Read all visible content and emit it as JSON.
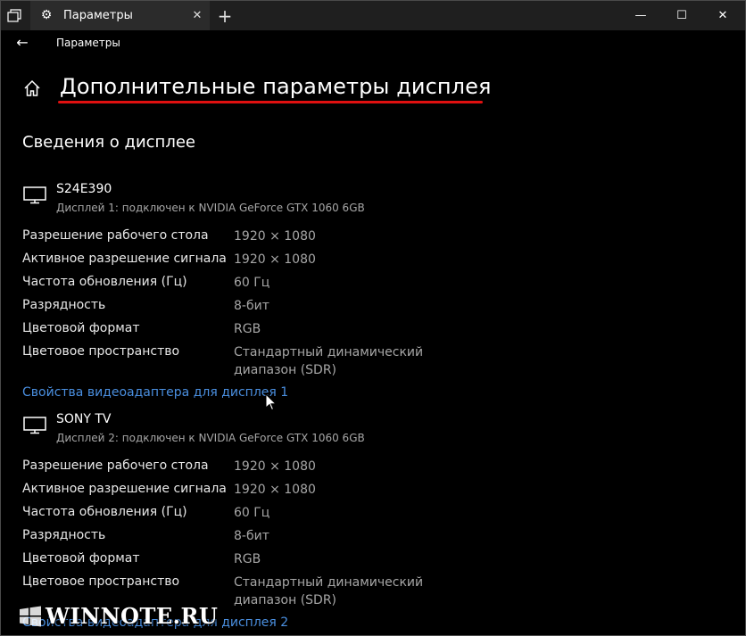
{
  "tab": {
    "title": "Параметры"
  },
  "nav": {
    "title": "Параметры"
  },
  "page": {
    "title": "Дополнительные параметры дисплея",
    "section_title": "Сведения о дисплее"
  },
  "displays": [
    {
      "name": "S24E390",
      "subtitle": "Дисплей 1: подключен к NVIDIA GeForce GTX 1060 6GB",
      "rows": [
        {
          "label": "Разрешение рабочего стола",
          "value": "1920 × 1080"
        },
        {
          "label": "Активное разрешение сигнала",
          "value": "1920 × 1080"
        },
        {
          "label": "Частота обновления (Гц)",
          "value": "60 Гц"
        },
        {
          "label": "Разрядность",
          "value": "8-бит"
        },
        {
          "label": "Цветовой формат",
          "value": "RGB"
        },
        {
          "label": "Цветовое пространство",
          "value": "Стандартный динамический",
          "value2": "диапазон (SDR)"
        }
      ],
      "link": "Свойства видеоадаптера для дисплея 1"
    },
    {
      "name": "SONY TV",
      "subtitle": "Дисплей 2: подключен к NVIDIA GeForce GTX 1060 6GB",
      "rows": [
        {
          "label": "Разрешение рабочего стола",
          "value": "1920 × 1080"
        },
        {
          "label": "Активное разрешение сигнала",
          "value": "1920 × 1080"
        },
        {
          "label": "Частота обновления (Гц)",
          "value": "60 Гц"
        },
        {
          "label": "Разрядность",
          "value": "8-бит"
        },
        {
          "label": "Цветовой формат",
          "value": "RGB"
        },
        {
          "label": "Цветовое пространство",
          "value": "Стандартный динамический",
          "value2": "диапазон (SDR)"
        }
      ],
      "link": "Свойства видеоадаптера для дисплея 2"
    }
  ],
  "watermark": {
    "text": "WINNOTE.RU"
  },
  "colors": {
    "accent_red": "#e01010",
    "link": "#4a8fe0",
    "background": "#000000",
    "titlebar": "#1f1f1f"
  }
}
